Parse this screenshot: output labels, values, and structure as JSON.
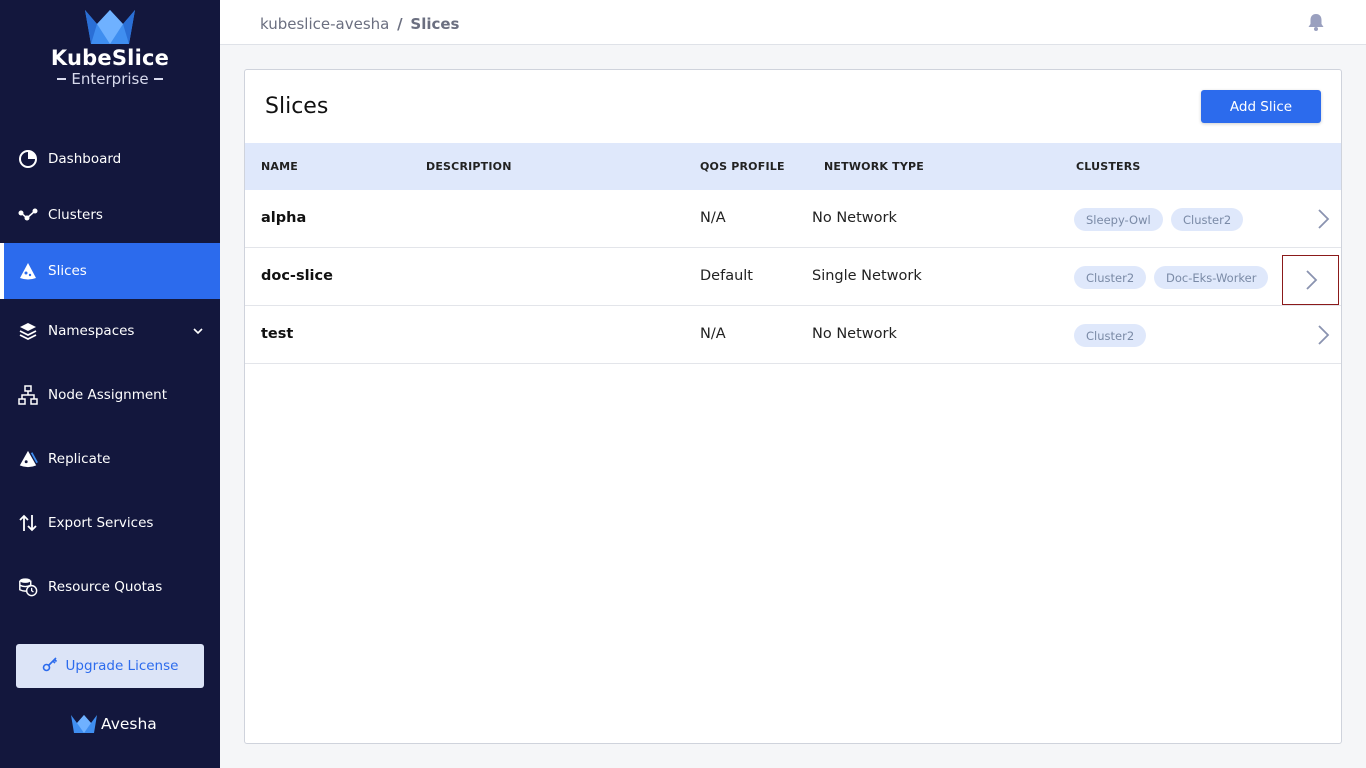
{
  "brand": {
    "title": "KubeSlice",
    "subtitle": "Enterprise",
    "footer": "Avesha",
    "colors": {
      "sidebar": "#13173d",
      "accent": "#2c6bed",
      "chip": "#dfe8fb"
    }
  },
  "sidebar": {
    "items": [
      {
        "label": "Dashboard",
        "icon": "pie-chart-icon"
      },
      {
        "label": "Clusters",
        "icon": "network-nodes-icon"
      },
      {
        "label": "Slices",
        "icon": "slice-icon",
        "active": true
      },
      {
        "label": "Namespaces",
        "icon": "layers-icon",
        "expandable": true
      },
      {
        "label": "Node Assignment",
        "icon": "hierarchy-icon"
      },
      {
        "label": "Replicate",
        "icon": "replicate-icon"
      },
      {
        "label": "Export Services",
        "icon": "arrows-up-down-icon"
      },
      {
        "label": "Resource Quotas",
        "icon": "database-clock-icon"
      }
    ],
    "upgrade_label": "Upgrade License"
  },
  "header": {
    "breadcrumb_root": "kubeslice-avesha",
    "breadcrumb_sep": "/",
    "breadcrumb_current": "Slices"
  },
  "main": {
    "title": "Slices",
    "add_button": "Add Slice",
    "columns": [
      "NAME",
      "DESCRIPTION",
      "QOS PROFILE",
      "NETWORK TYPE",
      "CLUSTERS"
    ],
    "rows": [
      {
        "name": "alpha",
        "description": "",
        "qos": "N/A",
        "network": "No Network",
        "clusters": [
          "Sleepy-Owl",
          "Cluster2"
        ]
      },
      {
        "name": "doc-slice",
        "description": "",
        "qos": "Default",
        "network": "Single Network",
        "clusters": [
          "Cluster2",
          "Doc-Eks-Worker"
        ]
      },
      {
        "name": "test",
        "description": "",
        "qos": "N/A",
        "network": "No Network",
        "clusters": [
          "Cluster2"
        ]
      }
    ]
  }
}
